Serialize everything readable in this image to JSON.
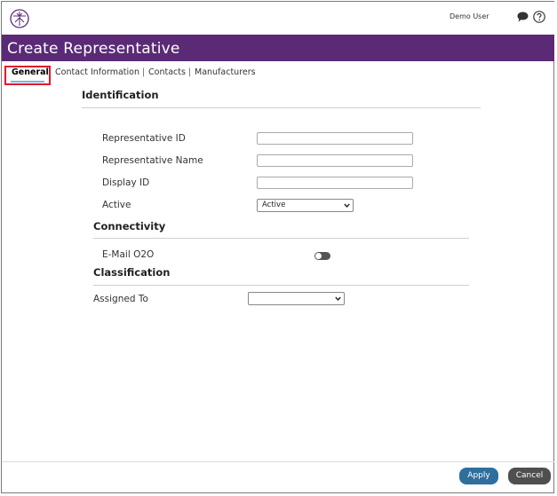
{
  "header": {
    "user_name": "Demo User"
  },
  "page": {
    "title": "Create Representative"
  },
  "tabs": [
    {
      "label": "General"
    },
    {
      "label": "Contact Information"
    },
    {
      "label": "Contacts"
    },
    {
      "label": "Manufacturers"
    }
  ],
  "tab_separator": "|",
  "sections": {
    "identification": {
      "title": "Identification",
      "representative_id_label": "Representative ID",
      "representative_name_label": "Representative Name",
      "display_id_label": "Display ID",
      "active_label": "Active",
      "active_value": "Active"
    },
    "connectivity": {
      "title": "Connectivity",
      "email_o2o_label": "E-Mail O2O"
    },
    "classification": {
      "title": "Classification",
      "assigned_to_label": "Assigned To",
      "assigned_to_value": ""
    }
  },
  "buttons": {
    "apply": "Apply",
    "cancel": "Cancel"
  },
  "colors": {
    "title_bar": "#5b2a76",
    "apply_button": "#2f6f9d",
    "cancel_button": "#4f4f4f",
    "active_tab_highlight": "#e0192a"
  }
}
